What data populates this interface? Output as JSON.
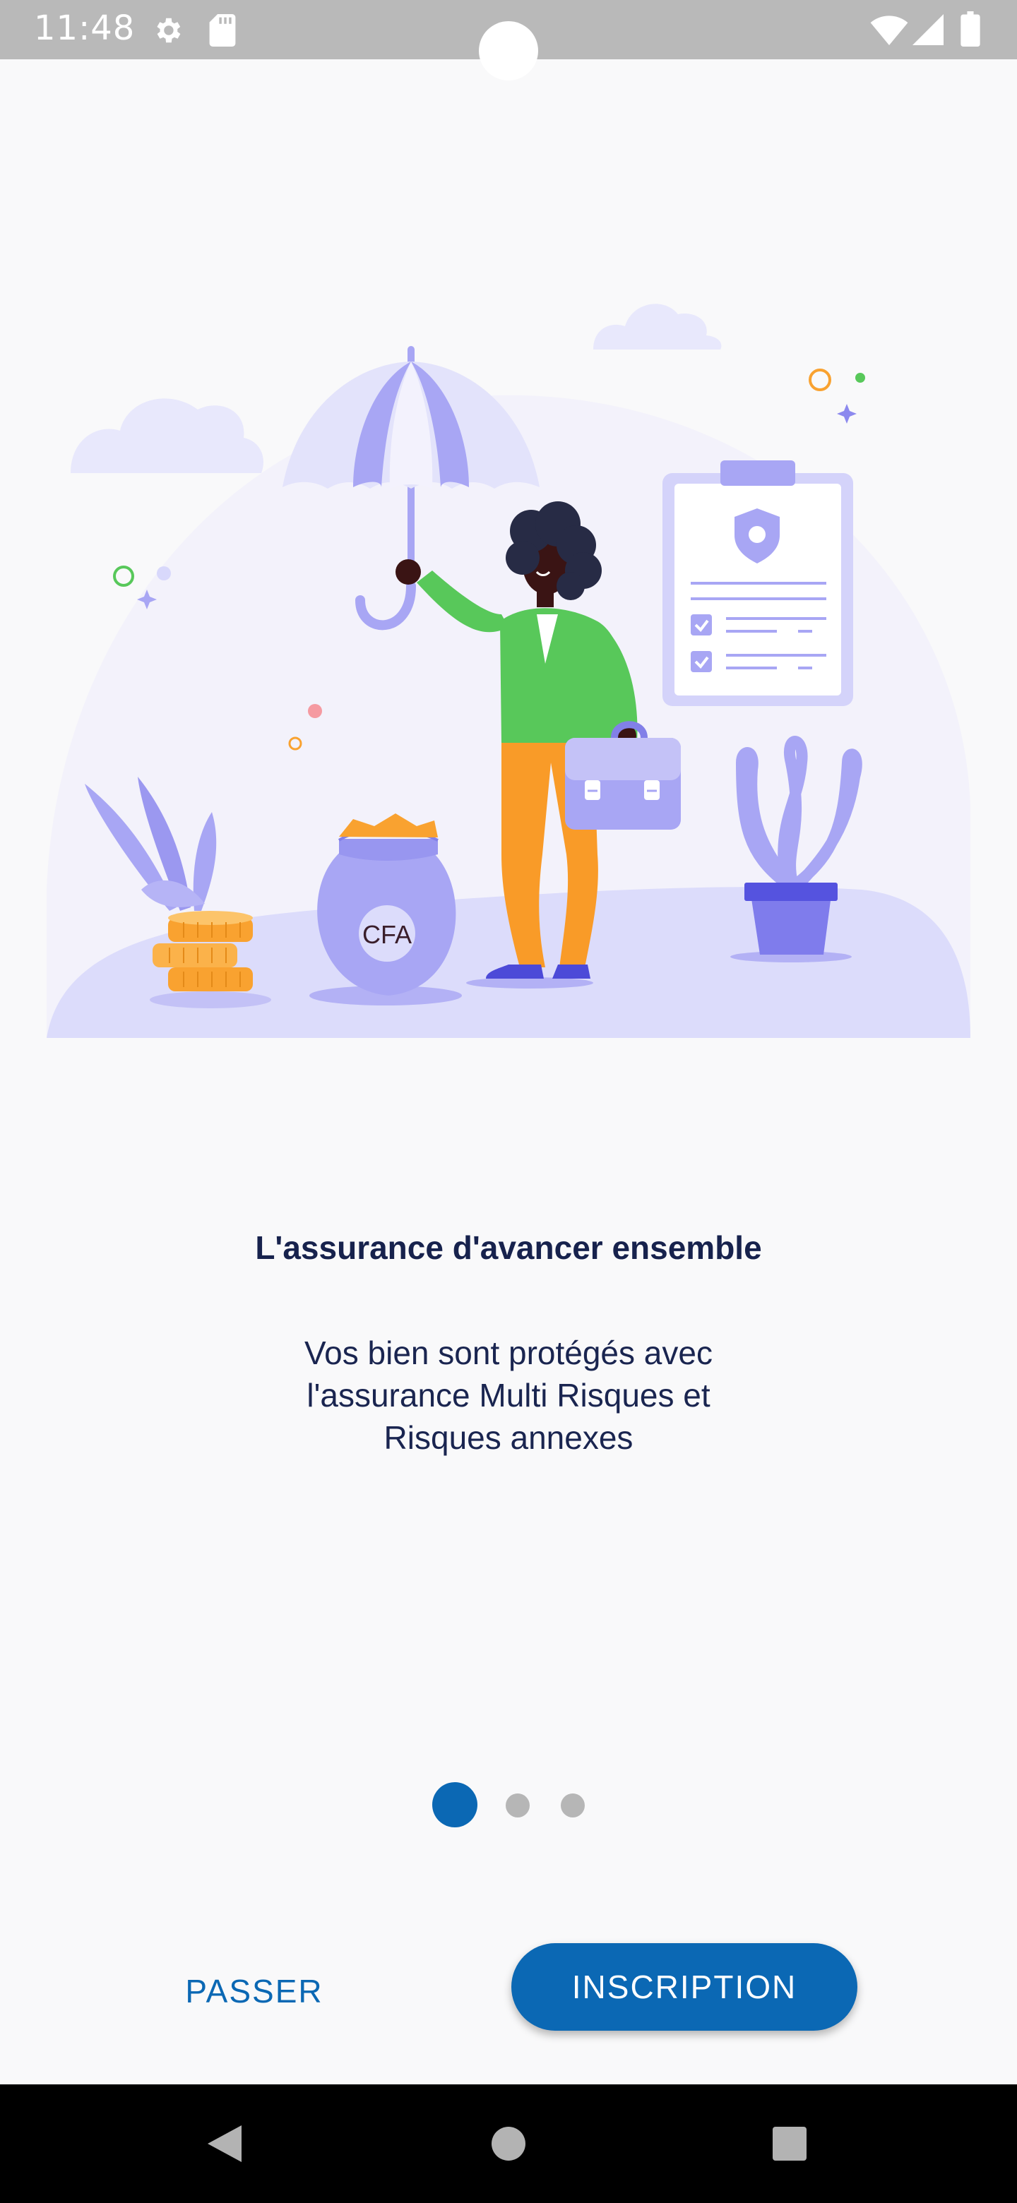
{
  "status_bar": {
    "time": "11:48",
    "left_icons": [
      "gear-icon",
      "sd-card-icon"
    ],
    "right_icons": [
      "wifi-icon",
      "signal-icon",
      "battery-icon"
    ]
  },
  "illustration": {
    "bag_label": "CFA"
  },
  "onboarding": {
    "title": "L'assurance d'avancer ensemble",
    "description": "Vos bien sont protégés avec\nl'assurance Multi Risques et\nRisques annexes",
    "page_indicator": {
      "current": 1,
      "total": 3
    }
  },
  "actions": {
    "skip_label": "PASSER",
    "signup_label": "INSCRIPTION"
  },
  "nav_bar": {
    "icons": [
      "back-icon",
      "home-icon",
      "recents-icon"
    ]
  },
  "colors": {
    "accent": "#0b68b4",
    "title": "#17224d",
    "illustration_purple": "#a8a6f4",
    "inactive_dot": "#b6b6b6"
  }
}
